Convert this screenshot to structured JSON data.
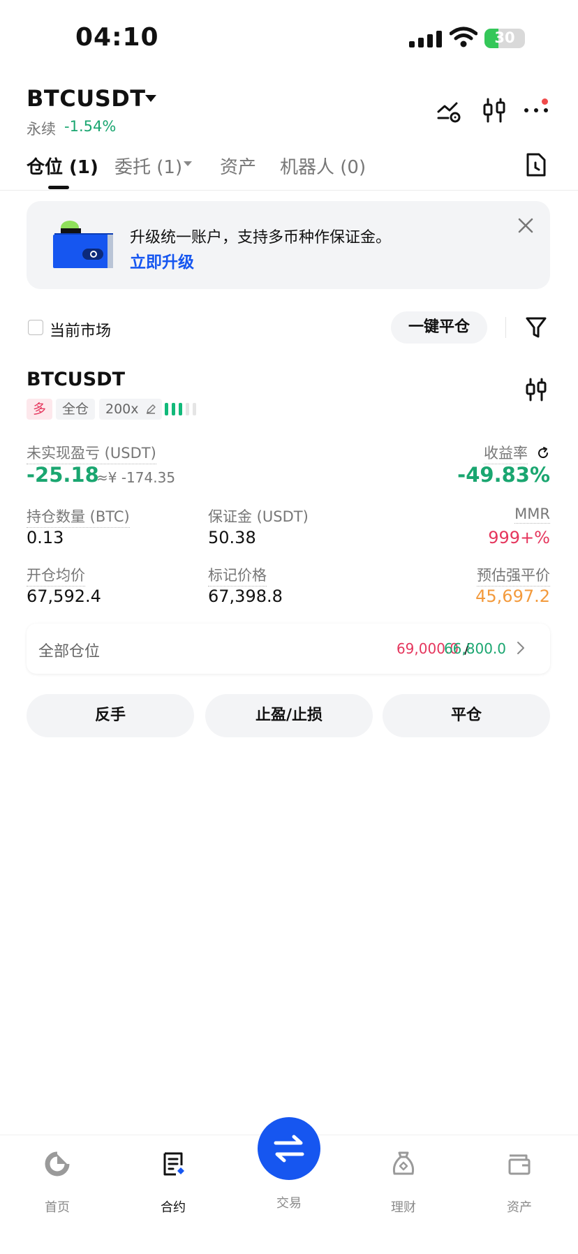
{
  "status_bar": {
    "time": "04:10",
    "battery": "30"
  },
  "header": {
    "symbol": "BTCUSDT",
    "type": "永续",
    "change": "-1.54%"
  },
  "tabs": [
    {
      "label": "仓位 (1)"
    },
    {
      "label": "委托 (1)"
    },
    {
      "label": "资产"
    },
    {
      "label": "机器人 (0)"
    }
  ],
  "banner": {
    "text": "升级统一账户，支持多币种作保证金。",
    "link": "立即升级"
  },
  "filter": {
    "checkbox_label": "当前市场",
    "close_all": "一键平仓"
  },
  "position": {
    "symbol": "BTCUSDT",
    "side": "多",
    "margin_mode": "全仓",
    "leverage": "200x",
    "unrealized_label": "未实现盈亏 (USDT)",
    "unrealized_value": "-25.18",
    "unrealized_cny": "≈¥ -174.35",
    "roe_label": "收益率",
    "roe_value": "-49.83%",
    "size_label": "持仓数量 (BTC)",
    "size_value": "0.13",
    "margin_label": "保证金 (USDT)",
    "margin_value": "50.38",
    "mmr_label": "MMR",
    "mmr_value": "999+%",
    "entry_label": "开仓均价",
    "entry_value": "67,592.4",
    "mark_label": "标记价格",
    "mark_value": "67,398.8",
    "liq_label": "预估强平价",
    "liq_value": "45,697.2",
    "all_positions_label": "全部仓位",
    "tp_value": "69,000.0",
    "sl_value": "66,800.0"
  },
  "actions": {
    "reverse": "反手",
    "tpsl": "止盈/止损",
    "close": "平仓"
  },
  "nav": [
    {
      "label": "首页",
      "icon": "home-icon"
    },
    {
      "label": "合约",
      "icon": "contract-icon"
    },
    {
      "label": "交易",
      "icon": "trade-swap-icon"
    },
    {
      "label": "理财",
      "icon": "earn-icon"
    },
    {
      "label": "资产",
      "icon": "wallet-icon"
    }
  ],
  "colors": {
    "accent": "#1656f0",
    "up": "#1aa670",
    "down": "#e5365d",
    "warning": "#f39a3c"
  }
}
